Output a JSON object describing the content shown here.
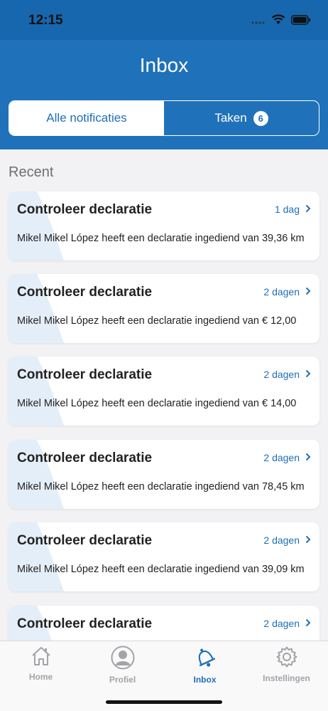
{
  "status_bar": {
    "time": "12:15"
  },
  "header": {
    "title": "Inbox"
  },
  "segment": {
    "tabs": [
      {
        "label": "Alle notificaties"
      },
      {
        "label": "Taken",
        "badge": "6"
      }
    ]
  },
  "section": {
    "label": "Recent"
  },
  "notifications": [
    {
      "title": "Controleer declaratie",
      "time": "1 dag",
      "body": "Mikel Mikel López heeft een declaratie ingediend van 39,36 km"
    },
    {
      "title": "Controleer declaratie",
      "time": "2 dagen",
      "body": "Mikel Mikel López heeft een declaratie ingediend van € 12,00"
    },
    {
      "title": "Controleer declaratie",
      "time": "2 dagen",
      "body": "Mikel Mikel López heeft een declaratie ingediend van € 14,00"
    },
    {
      "title": "Controleer declaratie",
      "time": "2 dagen",
      "body": "Mikel Mikel López heeft een declaratie ingediend van 78,45 km"
    },
    {
      "title": "Controleer declaratie",
      "time": "2 dagen",
      "body": "Mikel Mikel López heeft een declaratie ingediend van 39,09 km"
    },
    {
      "title": "Controleer declaratie",
      "time": "2 dagen",
      "body": ""
    }
  ],
  "tabbar": {
    "items": [
      {
        "label": "Home",
        "icon": "home-icon"
      },
      {
        "label": "Profiel",
        "icon": "profile-icon"
      },
      {
        "label": "Inbox",
        "icon": "bell-icon",
        "active": true
      },
      {
        "label": "Instellingen",
        "icon": "gear-icon"
      }
    ]
  },
  "colors": {
    "brand": "#1f72b9",
    "accent": "#1f6fb5",
    "inactive_tab": "#a3a3a8"
  }
}
